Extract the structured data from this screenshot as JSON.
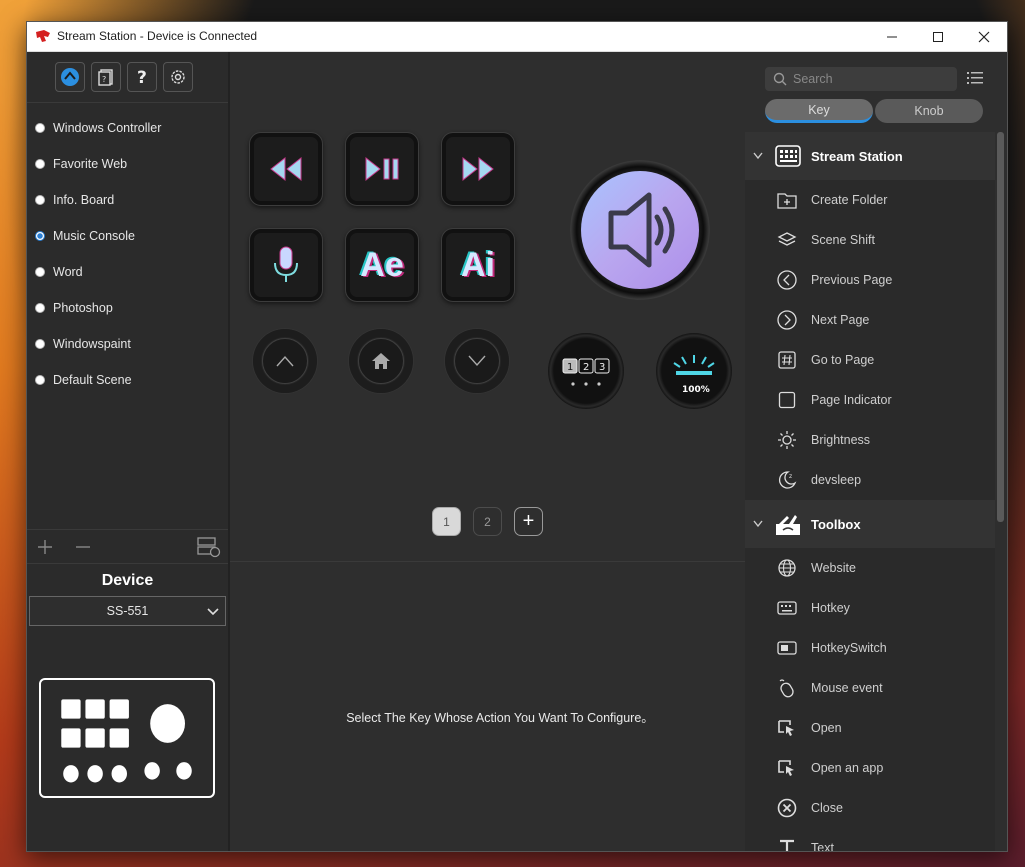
{
  "window": {
    "title": "Stream Station - Device is Connected"
  },
  "left": {
    "scenes": [
      {
        "label": "Windows Controller",
        "selected": false
      },
      {
        "label": "Favorite Web",
        "selected": false
      },
      {
        "label": "Info. Board",
        "selected": false
      },
      {
        "label": "Music Console",
        "selected": true
      },
      {
        "label": "Word",
        "selected": false
      },
      {
        "label": "Photoshop",
        "selected": false
      },
      {
        "label": "Windowspaint",
        "selected": false
      },
      {
        "label": "Default Scene",
        "selected": false
      }
    ],
    "device_title": "Device",
    "device_value": "SS-551"
  },
  "center": {
    "keys": {
      "ae": "Ae",
      "ai": "Ai"
    },
    "knob_small_pages": [
      "1",
      "2",
      "3"
    ],
    "knob_small_brightness": "100%",
    "pages": [
      "1",
      "2"
    ],
    "add_page": "+",
    "config_message": "Select The Key Whose Action You Want To Configure。"
  },
  "right": {
    "search_placeholder": "Search",
    "tabs": [
      "Key",
      "Knob"
    ],
    "groups": [
      {
        "label": "Stream Station",
        "items": [
          "Create Folder",
          "Scene Shift",
          "Previous Page",
          "Next Page",
          "Go to Page",
          "Page Indicator",
          "Brightness",
          "devsleep"
        ]
      },
      {
        "label": "Toolbox",
        "items": [
          "Website",
          "Hotkey",
          "HotkeySwitch",
          "Mouse event",
          "Open",
          "Open an app",
          "Close",
          "Text"
        ]
      }
    ]
  },
  "colors": {
    "accent": "#2b8fe0",
    "radio_selected": "#2b7fd4"
  }
}
